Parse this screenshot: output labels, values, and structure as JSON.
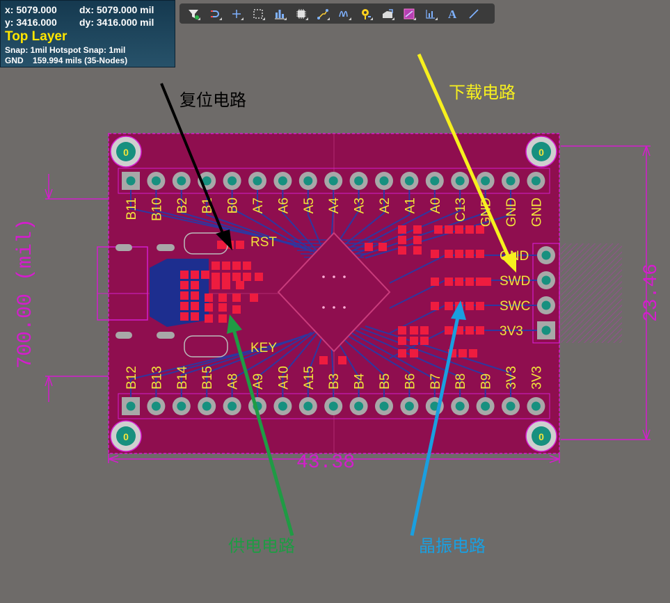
{
  "hud": {
    "x_label": "x:",
    "x_value": "5079.000",
    "dx_label": "dx:",
    "dx_value": "5079.000 mil",
    "y_label": "y:",
    "y_value": "3416.000",
    "dy_label": "dy:",
    "dy_value": "3416.000 mil",
    "layer": "Top Layer",
    "snap": "Snap: 1mil Hotspot Snap: 1mil",
    "net_name": "GND",
    "net_info": "159.994 mils (35-Nodes)"
  },
  "toolbar": {
    "tools": [
      {
        "name": "filter-tool",
        "icon": "funnel-icon"
      },
      {
        "name": "route-tool",
        "icon": "magnet-icon"
      },
      {
        "name": "cross-tool",
        "icon": "plus-icon"
      },
      {
        "name": "select-rect-tool",
        "icon": "dashed-rect-icon"
      },
      {
        "name": "align-tool",
        "icon": "bars-icon"
      },
      {
        "name": "component-tool",
        "icon": "chip-icon"
      },
      {
        "name": "interactive-route-tool",
        "icon": "route-icon"
      },
      {
        "name": "diff-pair-tool",
        "icon": "wave-icon"
      },
      {
        "name": "via-tool",
        "icon": "pin-icon"
      },
      {
        "name": "polygon-tool",
        "icon": "polygon-icon"
      },
      {
        "name": "keepout-tool",
        "icon": "keepout-icon"
      },
      {
        "name": "dimension-tool",
        "icon": "dimension-icon"
      },
      {
        "name": "text-tool",
        "icon": "text-icon"
      },
      {
        "name": "line-tool",
        "icon": "line-icon"
      }
    ]
  },
  "board": {
    "top_pin_labels": [
      "B11",
      "B10",
      "B2",
      "B1",
      "B0",
      "A7",
      "A6",
      "A5",
      "A4",
      "A3",
      "A2",
      "A1",
      "A0",
      "C13",
      "GND",
      "GND",
      "GND"
    ],
    "bottom_pin_labels": [
      "B12",
      "B13",
      "B14",
      "B15",
      "A8",
      "A9",
      "A10",
      "A15",
      "B3",
      "B4",
      "B5",
      "B6",
      "B7",
      "B8",
      "B9",
      "3V3",
      "3V3"
    ],
    "swd_labels": [
      "GND",
      "SWD",
      "SWC",
      "3V3"
    ],
    "rst_label": "RST",
    "key_label": "KEY",
    "mount_hole_label": "0",
    "dim_width": "43.38",
    "dim_height": "23.46",
    "dim_left": "700.00 (mil)"
  },
  "annotations": {
    "reset": "复位电路",
    "download": "下载电路",
    "power": "供电电路",
    "crystal": "晶振电路"
  },
  "colors": {
    "board": "#8f0e4f",
    "outline": "#d41dcd",
    "pad": "#a8a8a8",
    "pad_center": "#17907f",
    "copper": "#ee1c3f",
    "trace": "#2e37a0",
    "silkscreen": "#f2e53b",
    "reset_arrow": "#000000",
    "download_arrow": "#f7f01e",
    "power_arrow": "#1f9b44",
    "crystal_arrow": "#1a9fe0"
  }
}
